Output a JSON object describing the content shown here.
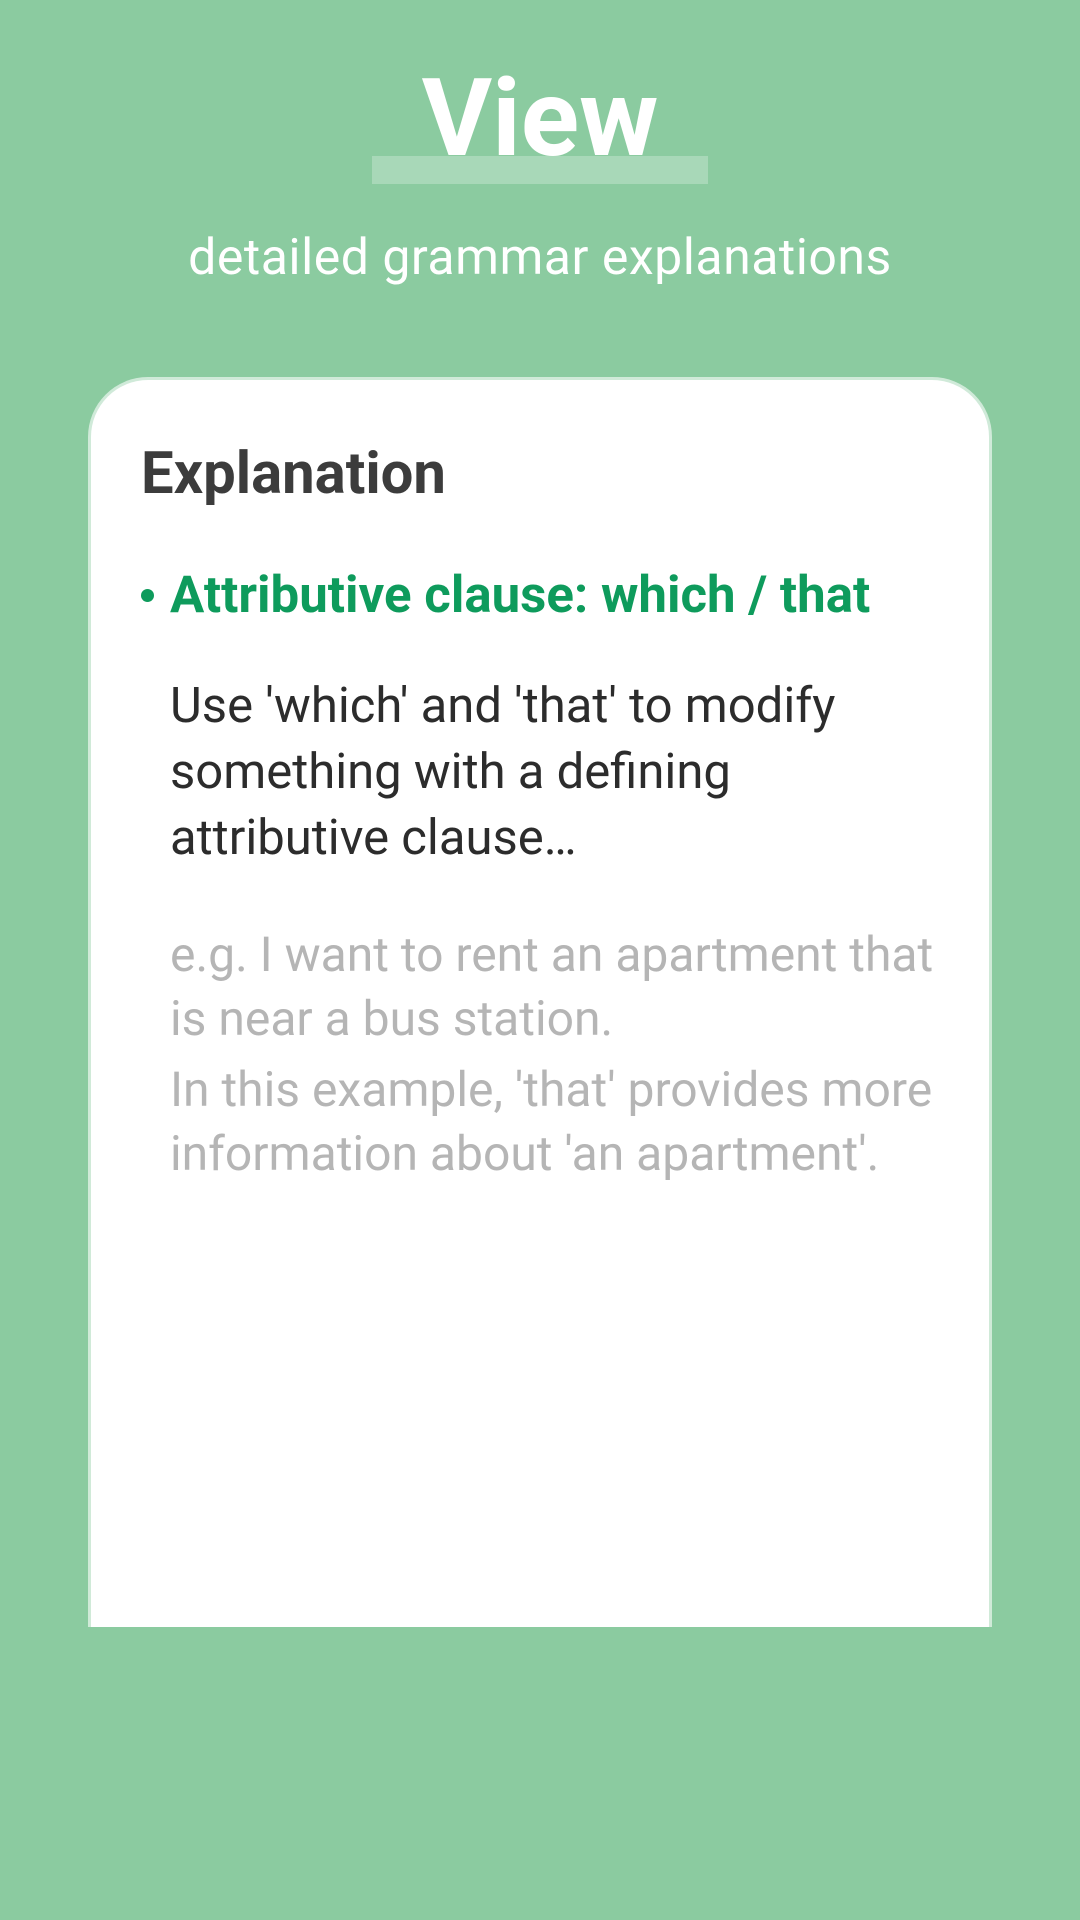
{
  "header": {
    "title": "View",
    "subtitle": "detailed grammar explanations"
  },
  "card": {
    "heading": "Explanation",
    "bullet_title": "Attributive clause: which / that",
    "body": "Use 'which' and 'that' to modify something with a defining attributive clause…",
    "example1": "e.g. I want to rent an apartment that is near a bus station.",
    "example2": "In this example, 'that' provides more information about 'an apartment'."
  }
}
